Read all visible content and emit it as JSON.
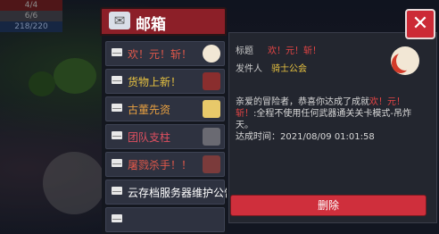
{
  "hud": {
    "hp": "4/4",
    "shield": "6/6",
    "energy": "218/220"
  },
  "mailbox": {
    "title": "邮箱",
    "items": [
      {
        "label": "欢！元！斩！",
        "color": "#e0584a",
        "thumb": "moon"
      },
      {
        "label": "货物上新！",
        "color": "#e8c340",
        "thumb": "box"
      },
      {
        "label": "古董先资",
        "color": "#e8a040",
        "thumb": "ticket"
      },
      {
        "label": "团队支柱",
        "color": "#e05060",
        "thumb": "hat"
      },
      {
        "label": "屠戮杀手！！",
        "color": "#e0584a",
        "thumb": "char"
      },
      {
        "label": "云存档服务器维护公告",
        "color": "#ffffff",
        "thumb": ""
      },
      {
        "label": "",
        "color": "#ffffff",
        "thumb": ""
      }
    ]
  },
  "detail": {
    "title_label": "标题",
    "title_value": "欢！元！斩！",
    "sender_label": "发件人",
    "sender_value": "骑士公会",
    "body_prefix": "亲爱的冒险者，恭喜你达成了成就",
    "body_achievement": "欢！元！斩！",
    "body_suffix": ":全程不使用任何武器通关关卡模式-吊炸天。",
    "time_label": "达成时间：",
    "time_value": "2021/08/09 01:01:58",
    "delete_label": "删除",
    "close_label": "✕"
  }
}
